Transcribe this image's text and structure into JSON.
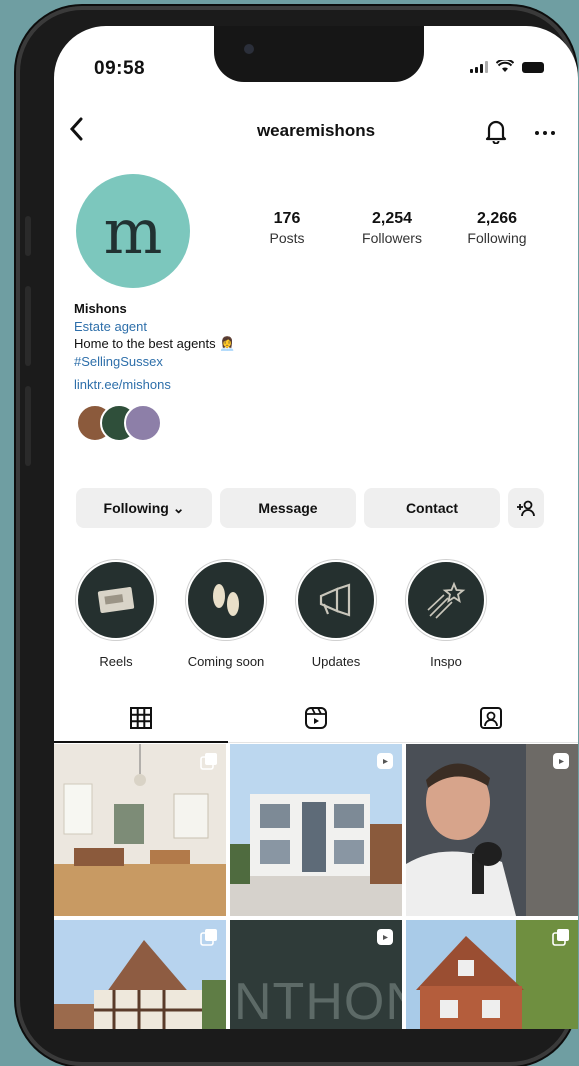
{
  "status": {
    "time": "09:58"
  },
  "header": {
    "username": "wearemishons",
    "back_icon": "chevron-left-icon",
    "bell_icon": "bell-icon",
    "more_icon": "more-dots-icon"
  },
  "profile": {
    "avatar_letter": "m",
    "avatar_color": "#7cc7bd",
    "stats": [
      {
        "value": "176",
        "label": "Posts"
      },
      {
        "value": "2,254",
        "label": "Followers"
      },
      {
        "value": "2,266",
        "label": "Following"
      }
    ],
    "name": "Mishons",
    "category": "Estate agent",
    "bio_line": "Home to the best agents 👩‍💼",
    "hashtag": "#SellingSussex",
    "link": "linktr.ee/mishons"
  },
  "actions": {
    "following": "Following ⌄",
    "message": "Message",
    "contact": "Contact",
    "add_user_icon": "add-user-icon"
  },
  "highlights": [
    {
      "label": "Reels",
      "icon": "card-icon"
    },
    {
      "label": "Coming soon",
      "icon": "footprints-icon"
    },
    {
      "label": "Updates",
      "icon": "megaphone-icon"
    },
    {
      "label": "Inspo",
      "icon": "shooting-star-icon"
    }
  ],
  "tabs": [
    {
      "name": "grid",
      "icon": "grid-icon"
    },
    {
      "name": "reels",
      "icon": "reels-icon"
    },
    {
      "name": "tagged",
      "icon": "tagged-icon"
    }
  ],
  "grid_posts": [
    {
      "kind": "interior",
      "badge": "multi-photo-icon"
    },
    {
      "kind": "modern-house",
      "badge": "reels-icon"
    },
    {
      "kind": "person",
      "badge": "reels-icon"
    },
    {
      "kind": "tudor-house",
      "badge": "multi-photo-icon"
    },
    {
      "kind": "sign",
      "badge": "reels-icon",
      "text": "NTHON"
    },
    {
      "kind": "brick-house",
      "badge": "multi-photo-icon"
    }
  ],
  "colors": {
    "accent_link": "#2e6faa",
    "highlight_bg": "#25302f",
    "page_bg": "#6f9ea2"
  }
}
